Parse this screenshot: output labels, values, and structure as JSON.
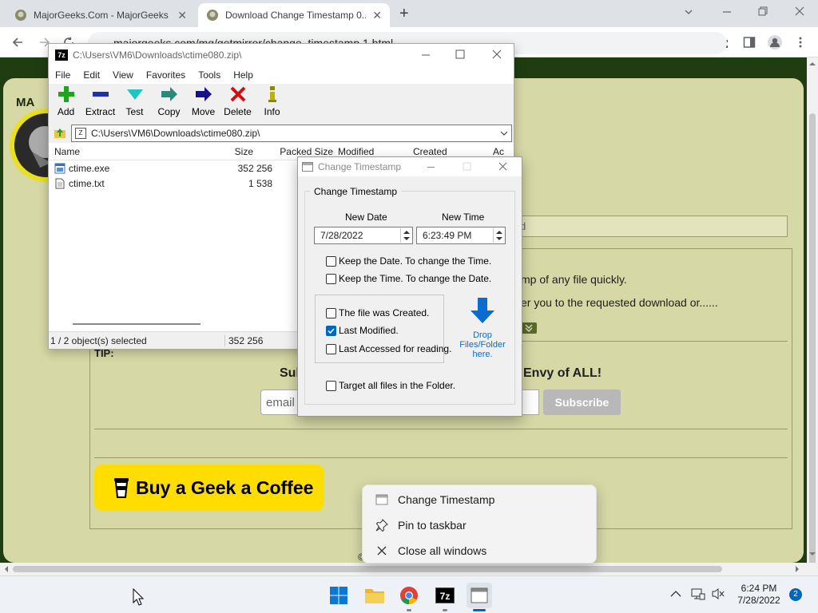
{
  "browser": {
    "tabs": [
      {
        "title": "MajorGeeks.Com - MajorGeeks",
        "close": "✕"
      },
      {
        "title": "Download Change Timestamp 0...",
        "close": "✕"
      }
    ],
    "new_tab": "+",
    "url": "majorgeeks.com/mg/getmirror/change_timestamp,1.html"
  },
  "page": {
    "logo_text": "MA",
    "tip": "TIP:",
    "search_placeholder": "d",
    "line1": "mp of any file quickly.",
    "line2": "er you to the requested download or......",
    "subscribe_left": "Sul",
    "subscribe_right": "Envy of ALL!",
    "email_placeholder": "email",
    "subscribe_button": "Subscribe",
    "coffee_label": "Buy a Geek a Coffee",
    "bottom_char": "©"
  },
  "zip": {
    "title": "C:\\Users\\VM6\\Downloads\\ctime080.zip\\",
    "menu": [
      "File",
      "Edit",
      "View",
      "Favorites",
      "Tools",
      "Help"
    ],
    "tools": [
      {
        "label": "Add",
        "icon": "add-icon"
      },
      {
        "label": "Extract",
        "icon": "extract-icon"
      },
      {
        "label": "Test",
        "icon": "test-icon"
      },
      {
        "label": "Copy",
        "icon": "copy-icon"
      },
      {
        "label": "Move",
        "icon": "move-icon"
      },
      {
        "label": "Delete",
        "icon": "delete-icon"
      },
      {
        "label": "Info",
        "icon": "info-icon"
      }
    ],
    "path": "C:\\Users\\VM6\\Downloads\\ctime080.zip\\",
    "columns": {
      "name": "Name",
      "size": "Size",
      "packed": "Packed Size",
      "modified": "Modified",
      "created": "Created",
      "accessed": "Ac"
    },
    "files": [
      {
        "name": "ctime.exe",
        "size": "352 256"
      },
      {
        "name": "ctime.txt",
        "size": "1 538"
      }
    ],
    "status_selected": "1 / 2 object(s) selected",
    "status_size": "352 256"
  },
  "dialog": {
    "title": "Change Timestamp",
    "group_label": "Change Timestamp",
    "new_date_label": "New Date",
    "new_time_label": "New Time",
    "date_value": "7/28/2022",
    "time_value": "6:23:49 PM",
    "keep_date": "Keep the Date. To change the Time.",
    "keep_time": "Keep the Time. To change the Date.",
    "options": [
      {
        "label": "The file was Created.",
        "checked": false
      },
      {
        "label": "Last Modified.",
        "checked": true
      },
      {
        "label": "Last Accessed for reading.",
        "checked": false
      }
    ],
    "drop_lines": [
      "Drop",
      "Files/Folder",
      "here."
    ],
    "target_all": "Target all files in the Folder."
  },
  "context_menu": {
    "items": [
      {
        "label": "Change Timestamp",
        "icon": "app-window-icon"
      },
      {
        "label": "Pin to taskbar",
        "icon": "pin-icon"
      },
      {
        "label": "Close all windows",
        "icon": "close-icon"
      }
    ]
  },
  "taskbar": {
    "time": "6:24 PM",
    "date": "7/28/2022",
    "notification_count": "2"
  },
  "colors": {
    "accent": "#0067c0",
    "web_dark_green": "#1f3d10",
    "web_panel": "#d6d8a6",
    "coffee_yellow": "#ffdd00"
  }
}
